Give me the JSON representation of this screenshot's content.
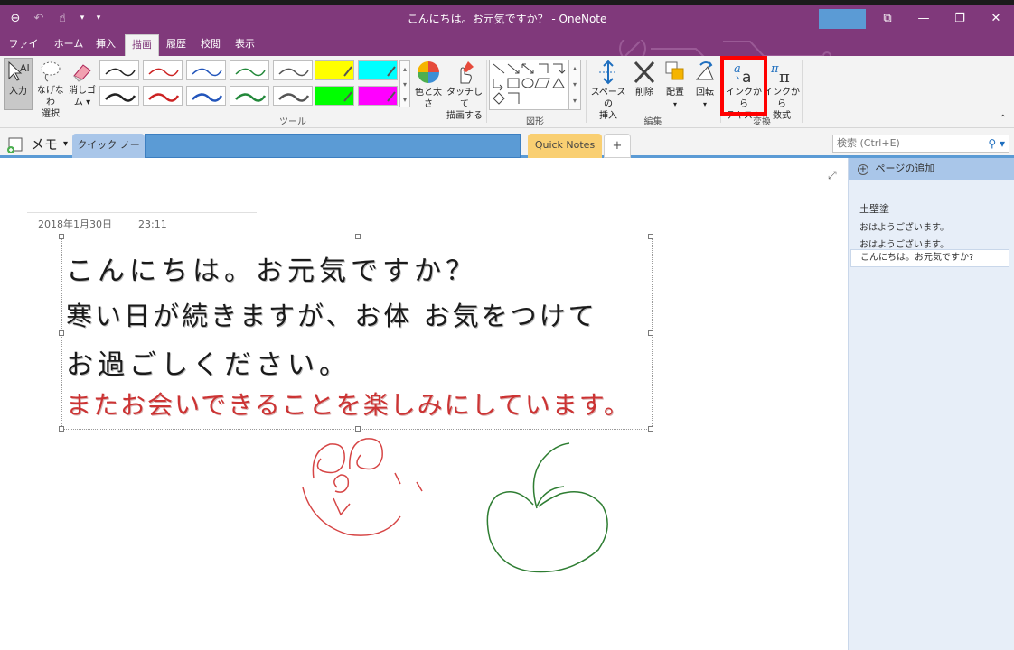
{
  "window": {
    "title": "こんにちは。お元気ですか？ - OneNote",
    "qat_back_icon": "back-arrow-icon",
    "qat_undo_icon": "undo-icon",
    "qat_touch_icon": "touch-mode-icon"
  },
  "tabs": [
    "ファイル",
    "ホーム",
    "挿入",
    "描画",
    "履歴",
    "校閲",
    "表示"
  ],
  "active_tab": "描画",
  "ribbon": {
    "input_label": "入力",
    "lasso_label_1": "なげなわ",
    "lasso_label_2": "選択",
    "eraser_label_1": "消しゴ",
    "eraser_label_2": "ム",
    "color_label": "色と太さ",
    "touch_draw_label_1": "タッチして",
    "touch_draw_label_2": "描画する",
    "tools_group": "ツール",
    "shapes_group": "図形",
    "space_label_1": "スペースの",
    "space_label_2": "挿入",
    "delete_label": "削除",
    "arrange_label": "配置",
    "rotate_label": "回転",
    "edit_group": "編集",
    "ink_to_text_1": "インクから",
    "ink_to_text_2": "テキスト",
    "ink_to_math_1": "インクから",
    "ink_to_math_2": "数式",
    "convert_group": "変換",
    "pen_colors": [
      "#222222",
      "#cc2222",
      "#2255bb",
      "#22883a",
      "#555555",
      "#ffff00",
      "#00ffff",
      "#222222",
      "#cc2222",
      "#2255bb",
      "#22883a",
      "#555555",
      "#00ff00",
      "#ff00ff"
    ]
  },
  "notebook": {
    "name": "メモ",
    "section_quick": "クイック ノート",
    "section_quick_notes": "Quick Notes",
    "add_section": "+"
  },
  "search": {
    "placeholder": "検索 (Ctrl+E)"
  },
  "page": {
    "date": "2018年1月30日",
    "time": "23:11",
    "lines": [
      "こんにちは。お元気ですか？",
      "寒い日が続きますが、お体 お気をつけて",
      "お過ごしください。",
      "またお会いできることを楽しみにしています。"
    ]
  },
  "pages_pane": {
    "add_page": "ページの追加",
    "items": [
      "土壁塗",
      "おはようございます。",
      "おはようございます。",
      "こんにちは。お元気ですか?"
    ]
  }
}
